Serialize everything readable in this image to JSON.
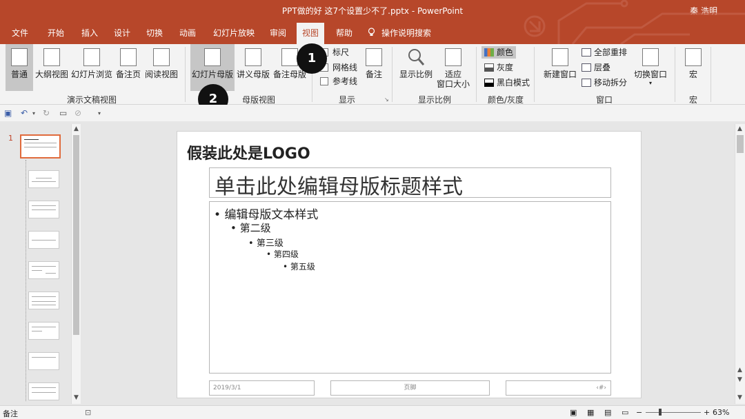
{
  "window": {
    "title": "PPT做的好 这7个设置少不了.pptx  -  PowerPoint",
    "user": "秦 浩明"
  },
  "tabs": [
    "文件",
    "开始",
    "插入",
    "设计",
    "切换",
    "动画",
    "幻灯片放映",
    "审阅",
    "视图",
    "帮助",
    "操作说明搜索"
  ],
  "ribbon": {
    "presentation_views": {
      "group": "演示文稿视图",
      "buttons": [
        "普通",
        "大纲视图",
        "幻灯片浏览",
        "备注页",
        "阅读视图"
      ]
    },
    "master_views": {
      "group": "母版视图",
      "buttons": [
        "幻灯片母版",
        "讲义母版",
        "备注母版"
      ]
    },
    "show": {
      "group": "显示",
      "checkboxes": [
        "标尺",
        "网格线",
        "参考线"
      ],
      "notes": "备注"
    },
    "zoom": {
      "group": "显示比例",
      "zoom": "显示比例",
      "fit": "适应\n窗口大小"
    },
    "color": {
      "group": "颜色/灰度",
      "items": [
        "颜色",
        "灰度",
        "黑白模式"
      ]
    },
    "window": {
      "group": "窗口",
      "new_window": "新建窗口",
      "items": [
        "全部重排",
        "层叠",
        "移动拆分"
      ],
      "switch": "切换窗口"
    },
    "macros": {
      "group": "宏",
      "button": "宏"
    }
  },
  "annotations": [
    "1",
    "2"
  ],
  "thumbnails": {
    "selected_number": "1"
  },
  "slide": {
    "logo": "假装此处是LOGO",
    "title": "单击此处编辑母版标题样式",
    "levels": [
      "编辑母版文本样式",
      "第二级",
      "第三级",
      "第四级",
      "第五级"
    ],
    "footer_date": "2019/3/1",
    "footer_text": "页脚",
    "footer_num": "‹#›"
  },
  "status": {
    "notes": "备注",
    "zoom": "63%"
  },
  "colors": {
    "accent": "#b7472a"
  }
}
